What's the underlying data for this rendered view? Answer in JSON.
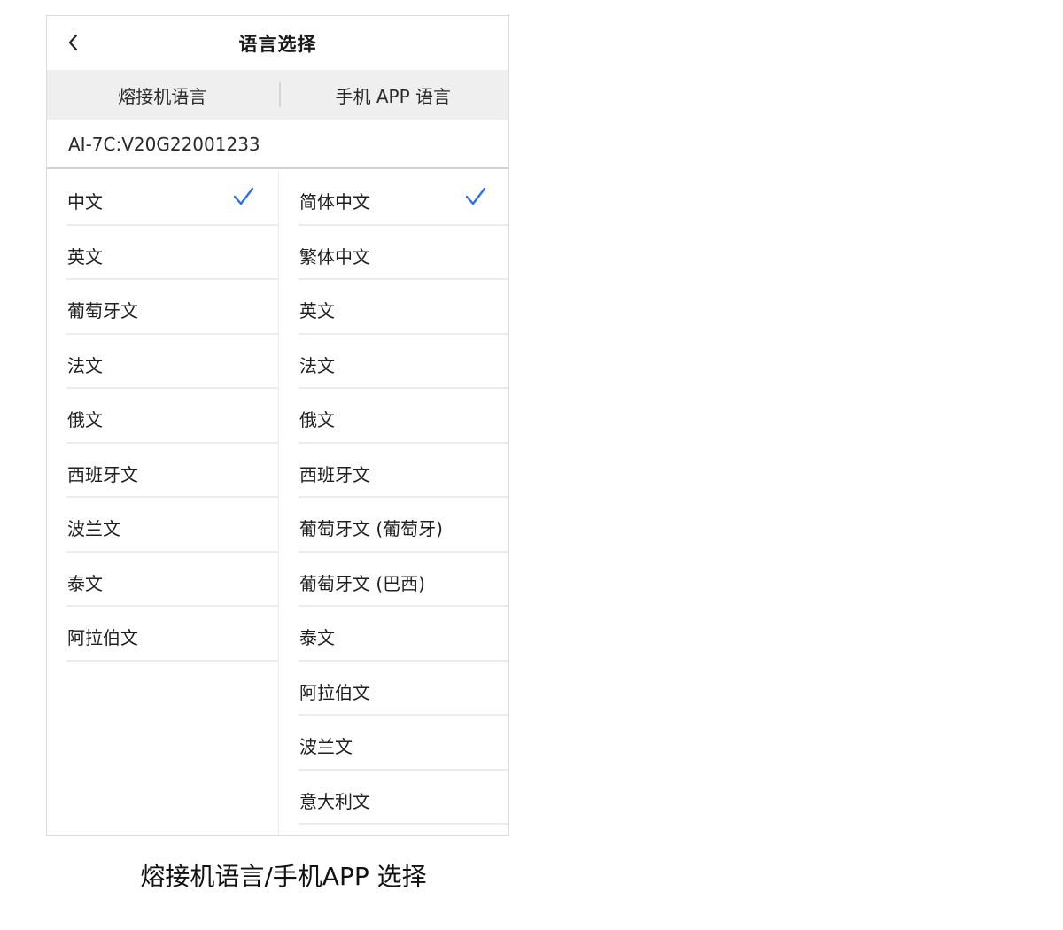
{
  "header": {
    "title": "语言选择",
    "back_icon": "chevron-left-icon"
  },
  "tabs": [
    {
      "label": "熔接机语言"
    },
    {
      "label": "手机 APP 语言"
    }
  ],
  "version": "AI-7C:V20G22001233",
  "machine_languages": [
    {
      "label": "中文",
      "selected": true
    },
    {
      "label": "英文",
      "selected": false
    },
    {
      "label": "葡萄牙文",
      "selected": false
    },
    {
      "label": "法文",
      "selected": false
    },
    {
      "label": "俄文",
      "selected": false
    },
    {
      "label": "西班牙文",
      "selected": false
    },
    {
      "label": "波兰文",
      "selected": false
    },
    {
      "label": "泰文",
      "selected": false
    },
    {
      "label": "阿拉伯文",
      "selected": false
    }
  ],
  "app_languages": [
    {
      "label": "简体中文",
      "selected": true
    },
    {
      "label": "繁体中文",
      "selected": false
    },
    {
      "label": "英文",
      "selected": false
    },
    {
      "label": "法文",
      "selected": false
    },
    {
      "label": "俄文",
      "selected": false
    },
    {
      "label": "西班牙文",
      "selected": false
    },
    {
      "label": "葡萄牙文 (葡萄牙)",
      "selected": false
    },
    {
      "label": "葡萄牙文 (巴西)",
      "selected": false
    },
    {
      "label": "泰文",
      "selected": false
    },
    {
      "label": "阿拉伯文",
      "selected": false
    },
    {
      "label": "波兰文",
      "selected": false
    },
    {
      "label": "意大利文",
      "selected": false
    }
  ],
  "caption": "熔接机语言/手机APP 选择",
  "colors": {
    "accent": "#2f6fe8",
    "tab_bar_bg": "#efefef",
    "divider": "#ececec"
  }
}
